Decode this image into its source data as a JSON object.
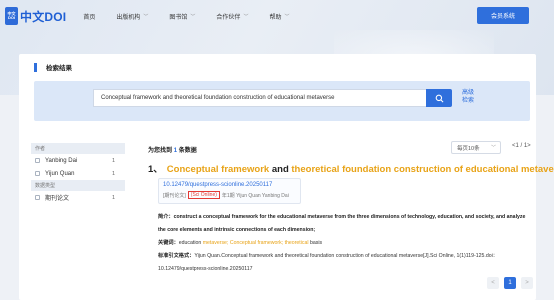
{
  "brand": {
    "mark_top": "中文",
    "mark_bottom": "DOI",
    "name": "中文DOI"
  },
  "nav": [
    {
      "label": "首页",
      "has_menu": false
    },
    {
      "label": "出版机构",
      "has_menu": true
    },
    {
      "label": "图书馆",
      "has_menu": true
    },
    {
      "label": "合作伙伴",
      "has_menu": true
    },
    {
      "label": "帮助",
      "has_menu": true
    }
  ],
  "member_button": "会员系统",
  "section_title": "检索结果",
  "search": {
    "value": "Conceptual framework and theoretical foundation construction of educational metaverse",
    "advanced_label": "高级\n检索"
  },
  "facets": {
    "author_title": "作者",
    "authors": [
      {
        "name": "Yanbing Dai",
        "count": "1"
      },
      {
        "name": "Yijun Quan",
        "count": "1"
      }
    ],
    "type_title": "数据类型",
    "types": [
      {
        "name": "期刊论文",
        "count": "1"
      }
    ]
  },
  "results_summary": {
    "prefix": "为您找到",
    "count": "1",
    "suffix": "条数据"
  },
  "per_page": "每页10条",
  "page_indicator": "<1 / 1>",
  "result": {
    "index": "1、",
    "title_parts": [
      {
        "text": "Conceptual framework",
        "hl": true
      },
      {
        "text": " and ",
        "hl": false
      },
      {
        "text": "theoretical foundation construction of educational metaverse",
        "hl": true
      }
    ],
    "doi": "10.12479/questpress-scionline.20250117",
    "type_label": "[期刊论文]",
    "journal": "(Sci Online)",
    "issue_authors": "年1期 Yijun Quan Yanbing Dai",
    "abstract_label": "简介：",
    "abstract_parts": [
      {
        "text": "construct a ",
        "hl": false
      },
      {
        "text": "conceptual framework",
        "hl": true
      },
      {
        "text": " for the ",
        "hl": false
      },
      {
        "text": "educational metaverse",
        "hl": true
      },
      {
        "text": " from the three dimensions of technology, education, and society, and analyze the core elements and intrinsic connections of each dimension;",
        "hl": false
      }
    ],
    "keywords_label": "关键词：",
    "keywords_parts": [
      {
        "text": "education ",
        "hl": false
      },
      {
        "text": "metaverse; Conceptual framework; theoretical",
        "hl": true
      },
      {
        "text": " basis",
        "hl": false
      }
    ],
    "citation_label": "标准引文格式：",
    "citation": "Yijun Quan.Conceptual framework and theoretical foundation construction of educational metaverse[J].Sci Online, 1(1)119-125.doi：10.12479/questpress-scionline.20250117"
  },
  "pagination": {
    "prev": "<",
    "current": "1",
    "next": ">"
  },
  "colors": {
    "accent": "#2f6fdc",
    "highlight": "#e8a317",
    "journal_tag": "#e53935"
  }
}
